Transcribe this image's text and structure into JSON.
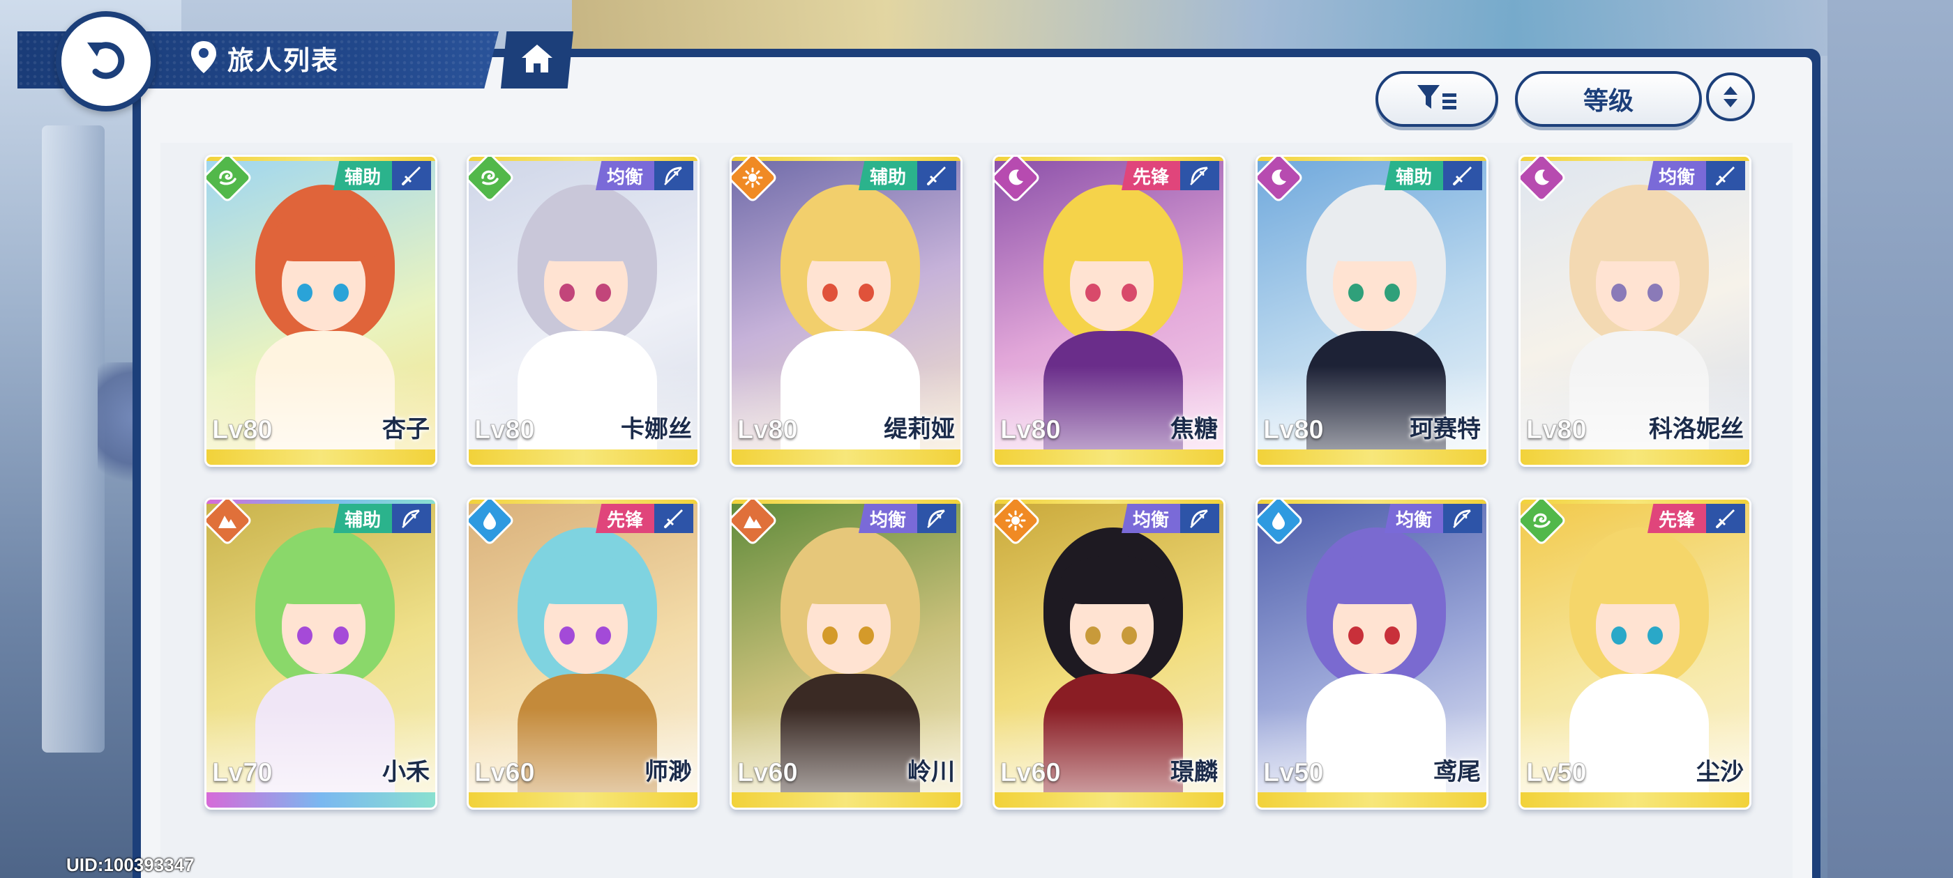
{
  "header": {
    "title": "旅人列表",
    "back_icon": "back-arrow-icon",
    "location_icon": "map-pin-icon",
    "home_icon": "home-icon"
  },
  "toolbar": {
    "filter_icon": "filter-icon",
    "sort_label": "等级",
    "order_icon": "sort-order-icon"
  },
  "uid": "UID:100393347",
  "colors": {
    "panel": "#1c3f7a",
    "role_support": "#2bb38c",
    "role_balance": "#7a6ad8",
    "role_vanguard": "#e0457b",
    "elem_wind": "#52b84a",
    "elem_light": "#f08a24",
    "elem_moon": "#b74bb0",
    "elem_earth": "#e0703a",
    "elem_water": "#2e9ae0"
  },
  "characters": [
    {
      "name": "杏子",
      "level": "Lv80",
      "role": "辅助",
      "element": "wind",
      "weapon": "sword"
    },
    {
      "name": "卡娜丝",
      "level": "Lv80",
      "role": "均衡",
      "element": "wind",
      "weapon": "bow"
    },
    {
      "name": "缇莉娅",
      "level": "Lv80",
      "role": "辅助",
      "element": "light",
      "weapon": "sword"
    },
    {
      "name": "焦糖",
      "level": "Lv80",
      "role": "先锋",
      "element": "moon",
      "weapon": "bow"
    },
    {
      "name": "珂赛特",
      "level": "Lv80",
      "role": "辅助",
      "element": "moon",
      "weapon": "sword"
    },
    {
      "name": "科洛妮丝",
      "level": "Lv80",
      "role": "均衡",
      "element": "moon",
      "weapon": "sword"
    },
    {
      "name": "小禾",
      "level": "Lv70",
      "role": "辅助",
      "element": "earth",
      "weapon": "bow"
    },
    {
      "name": "师渺",
      "level": "Lv60",
      "role": "先锋",
      "element": "water",
      "weapon": "sword"
    },
    {
      "name": "岭川",
      "level": "Lv60",
      "role": "均衡",
      "element": "earth",
      "weapon": "bow"
    },
    {
      "name": "璟麟",
      "level": "Lv60",
      "role": "均衡",
      "element": "light",
      "weapon": "bow"
    },
    {
      "name": "鸢尾",
      "level": "Lv50",
      "role": "均衡",
      "element": "water",
      "weapon": "bow"
    },
    {
      "name": "尘沙",
      "level": "Lv50",
      "role": "先锋",
      "element": "wind",
      "weapon": "sword"
    }
  ]
}
